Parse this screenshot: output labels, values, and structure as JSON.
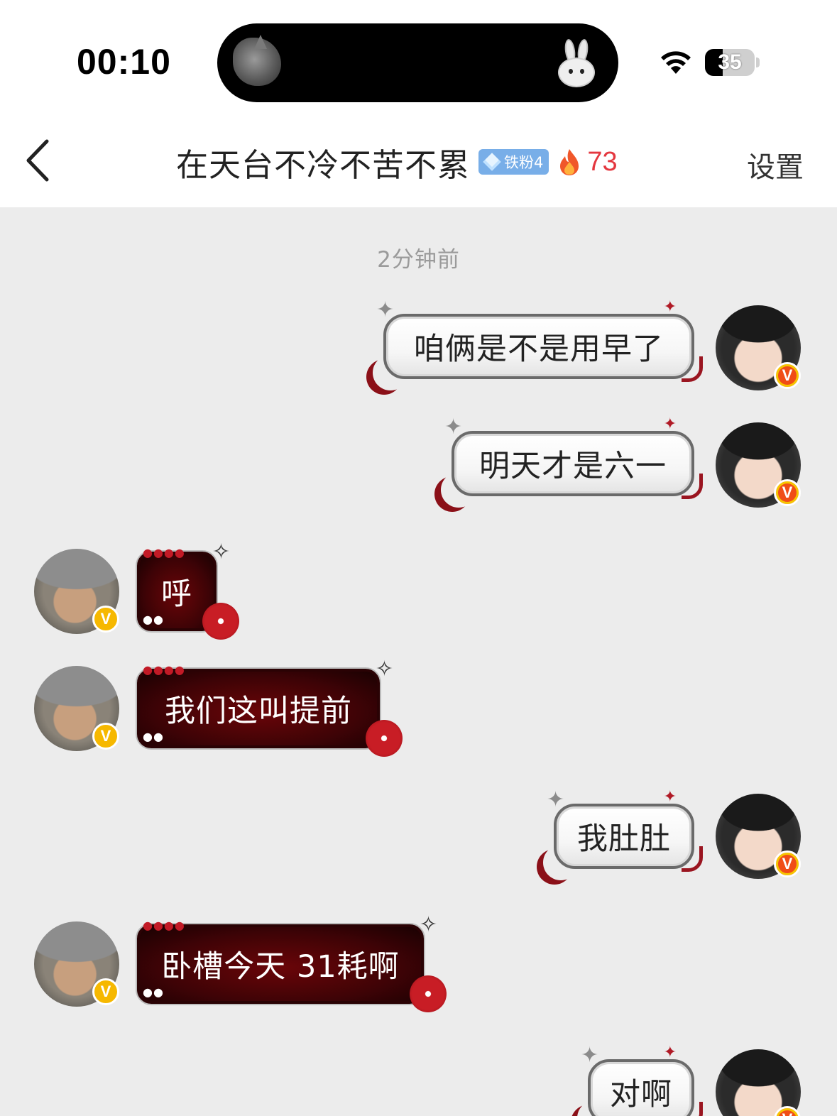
{
  "status_bar": {
    "time": "00:10",
    "battery": "35",
    "battery_fraction": 0.35
  },
  "header": {
    "title": "在天台不冷不苦不累",
    "fan_badge": "铁粉4",
    "streak": "73",
    "settings_label": "设置"
  },
  "chat": {
    "timestamp": "2分钟前",
    "messages": [
      {
        "side": "right",
        "text": "咱俩是不是用早了"
      },
      {
        "side": "right",
        "text": "明天才是六一"
      },
      {
        "side": "left",
        "text": "呼"
      },
      {
        "side": "left",
        "text": "我们这叫提前"
      },
      {
        "side": "right",
        "text": "我肚肚"
      },
      {
        "side": "left",
        "text": "卧槽今天 31耗啊"
      },
      {
        "side": "right",
        "text": "对啊"
      }
    ]
  },
  "colors": {
    "received_bubble": "#3e0306",
    "sent_bubble": "#ffffff",
    "streak": "#e4373f",
    "badge": "#78aee8"
  }
}
